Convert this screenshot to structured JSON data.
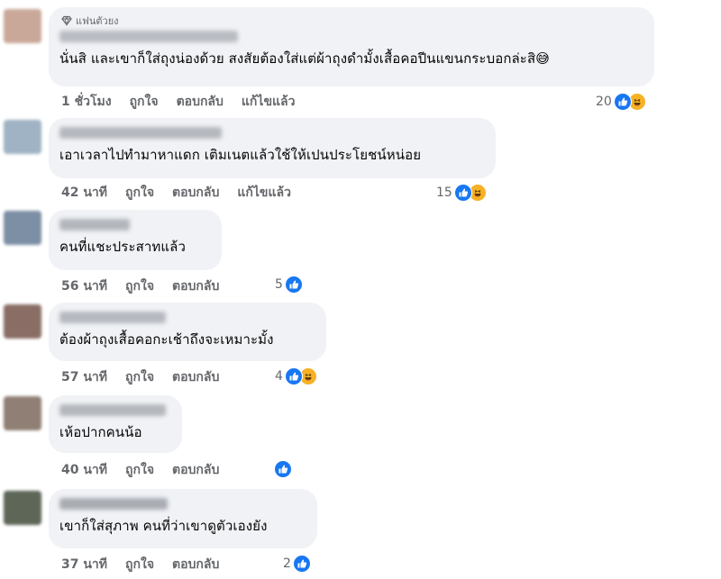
{
  "badge_label": "แฟนตัวยง",
  "comments": [
    {
      "text": "นั่นสิ และเขาก็ใส่ถุงน่องด้วย สงสัยต้องใส่แต่ผ้าถุงดำมั้งเสื้อคอปีนแขนกระบอกล่ะสิ😅",
      "time": "1 ชั่วโมง",
      "like": "ถูกใจ",
      "reply": "ตอบกลับ",
      "edited": "แก้ไขแล้ว",
      "reaction_count": "20",
      "reactions": [
        "like-icon",
        "haha-icon"
      ],
      "avatar_color": "#c9a89a",
      "name_color": "#b9bcc2"
    },
    {
      "text": "เอาเวลาไปทำมาหาแดก เติมเนตแล้วใช้ให้เปนประโยชน์หน่อย",
      "time": "42 นาที",
      "like": "ถูกใจ",
      "reply": "ตอบกลับ",
      "edited": "แก้ไขแล้ว",
      "reaction_count": "15",
      "reactions": [
        "like-icon",
        "haha-icon"
      ],
      "avatar_color": "#9fb3c4",
      "name_color": "#b5b8be"
    },
    {
      "text": "คนที่แชะประสาทแล้ว",
      "time": "56 นาที",
      "like": "ถูกใจ",
      "reply": "ตอบกลับ",
      "edited": "",
      "reaction_count": "5",
      "reactions": [
        "like-icon"
      ],
      "avatar_color": "#7d8fa5",
      "name_color": "#b3b7bd"
    },
    {
      "text": "ต้องผ้าถุงเสื้อคอกะเช้าถึงจะเหมาะมั้ง",
      "time": "57 นาที",
      "like": "ถูกใจ",
      "reply": "ตอบกลับ",
      "edited": "",
      "reaction_count": "4",
      "reactions": [
        "like-icon",
        "haha-icon"
      ],
      "avatar_color": "#8a6e66",
      "name_color": "#b6b9bf"
    },
    {
      "text": "เห้อปากคนน้อ",
      "time": "40 นาที",
      "like": "ถูกใจ",
      "reply": "ตอบกลับ",
      "edited": "",
      "reaction_count": "",
      "reactions": [
        "like-icon"
      ],
      "avatar_color": "#8f7f74",
      "name_color": "#b4b7bc"
    },
    {
      "text": "เขาก็ใส่สุภาพ คนที่ว่าเขาดูตัวเองยัง",
      "time": "37 นาที",
      "like": "ถูกใจ",
      "reply": "ตอบกลับ",
      "edited": "",
      "reaction_count": "2",
      "reactions": [
        "like-icon"
      ],
      "avatar_color": "#5d6657",
      "name_color": "#a9adb3"
    }
  ]
}
